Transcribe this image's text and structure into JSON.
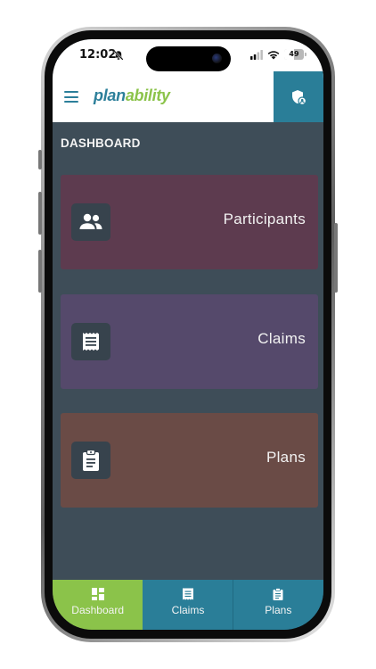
{
  "status_bar": {
    "time": "12:02",
    "battery": "49",
    "battery_level": 0.49
  },
  "header": {
    "logo_part_a": "plan",
    "logo_part_b": "ability",
    "menu_icon": "hamburger-menu-icon",
    "profile_button_icon": "user-shield-icon"
  },
  "dashboard": {
    "title": "DASHBOARD",
    "cards": [
      {
        "label": "Participants",
        "icon": "people-icon",
        "color": "#5d3b4f"
      },
      {
        "label": "Claims",
        "icon": "receipt-icon",
        "color": "#55496b"
      },
      {
        "label": "Plans",
        "icon": "clipboard-icon",
        "color": "#6a4b46"
      }
    ]
  },
  "tab_bar": {
    "tabs": [
      {
        "label": "Dashboard",
        "icon": "dashboard-grid-icon",
        "active": true,
        "color": "#8bc34a"
      },
      {
        "label": "Claims",
        "icon": "receipt-icon",
        "active": false,
        "color": "#2a7e98"
      },
      {
        "label": "Plans",
        "icon": "clipboard-icon",
        "active": false,
        "color": "#2a7e98"
      }
    ]
  },
  "colors": {
    "brand_teal": "#2a7e98",
    "brand_green": "#8bc34a",
    "background": "#3e4d58"
  }
}
